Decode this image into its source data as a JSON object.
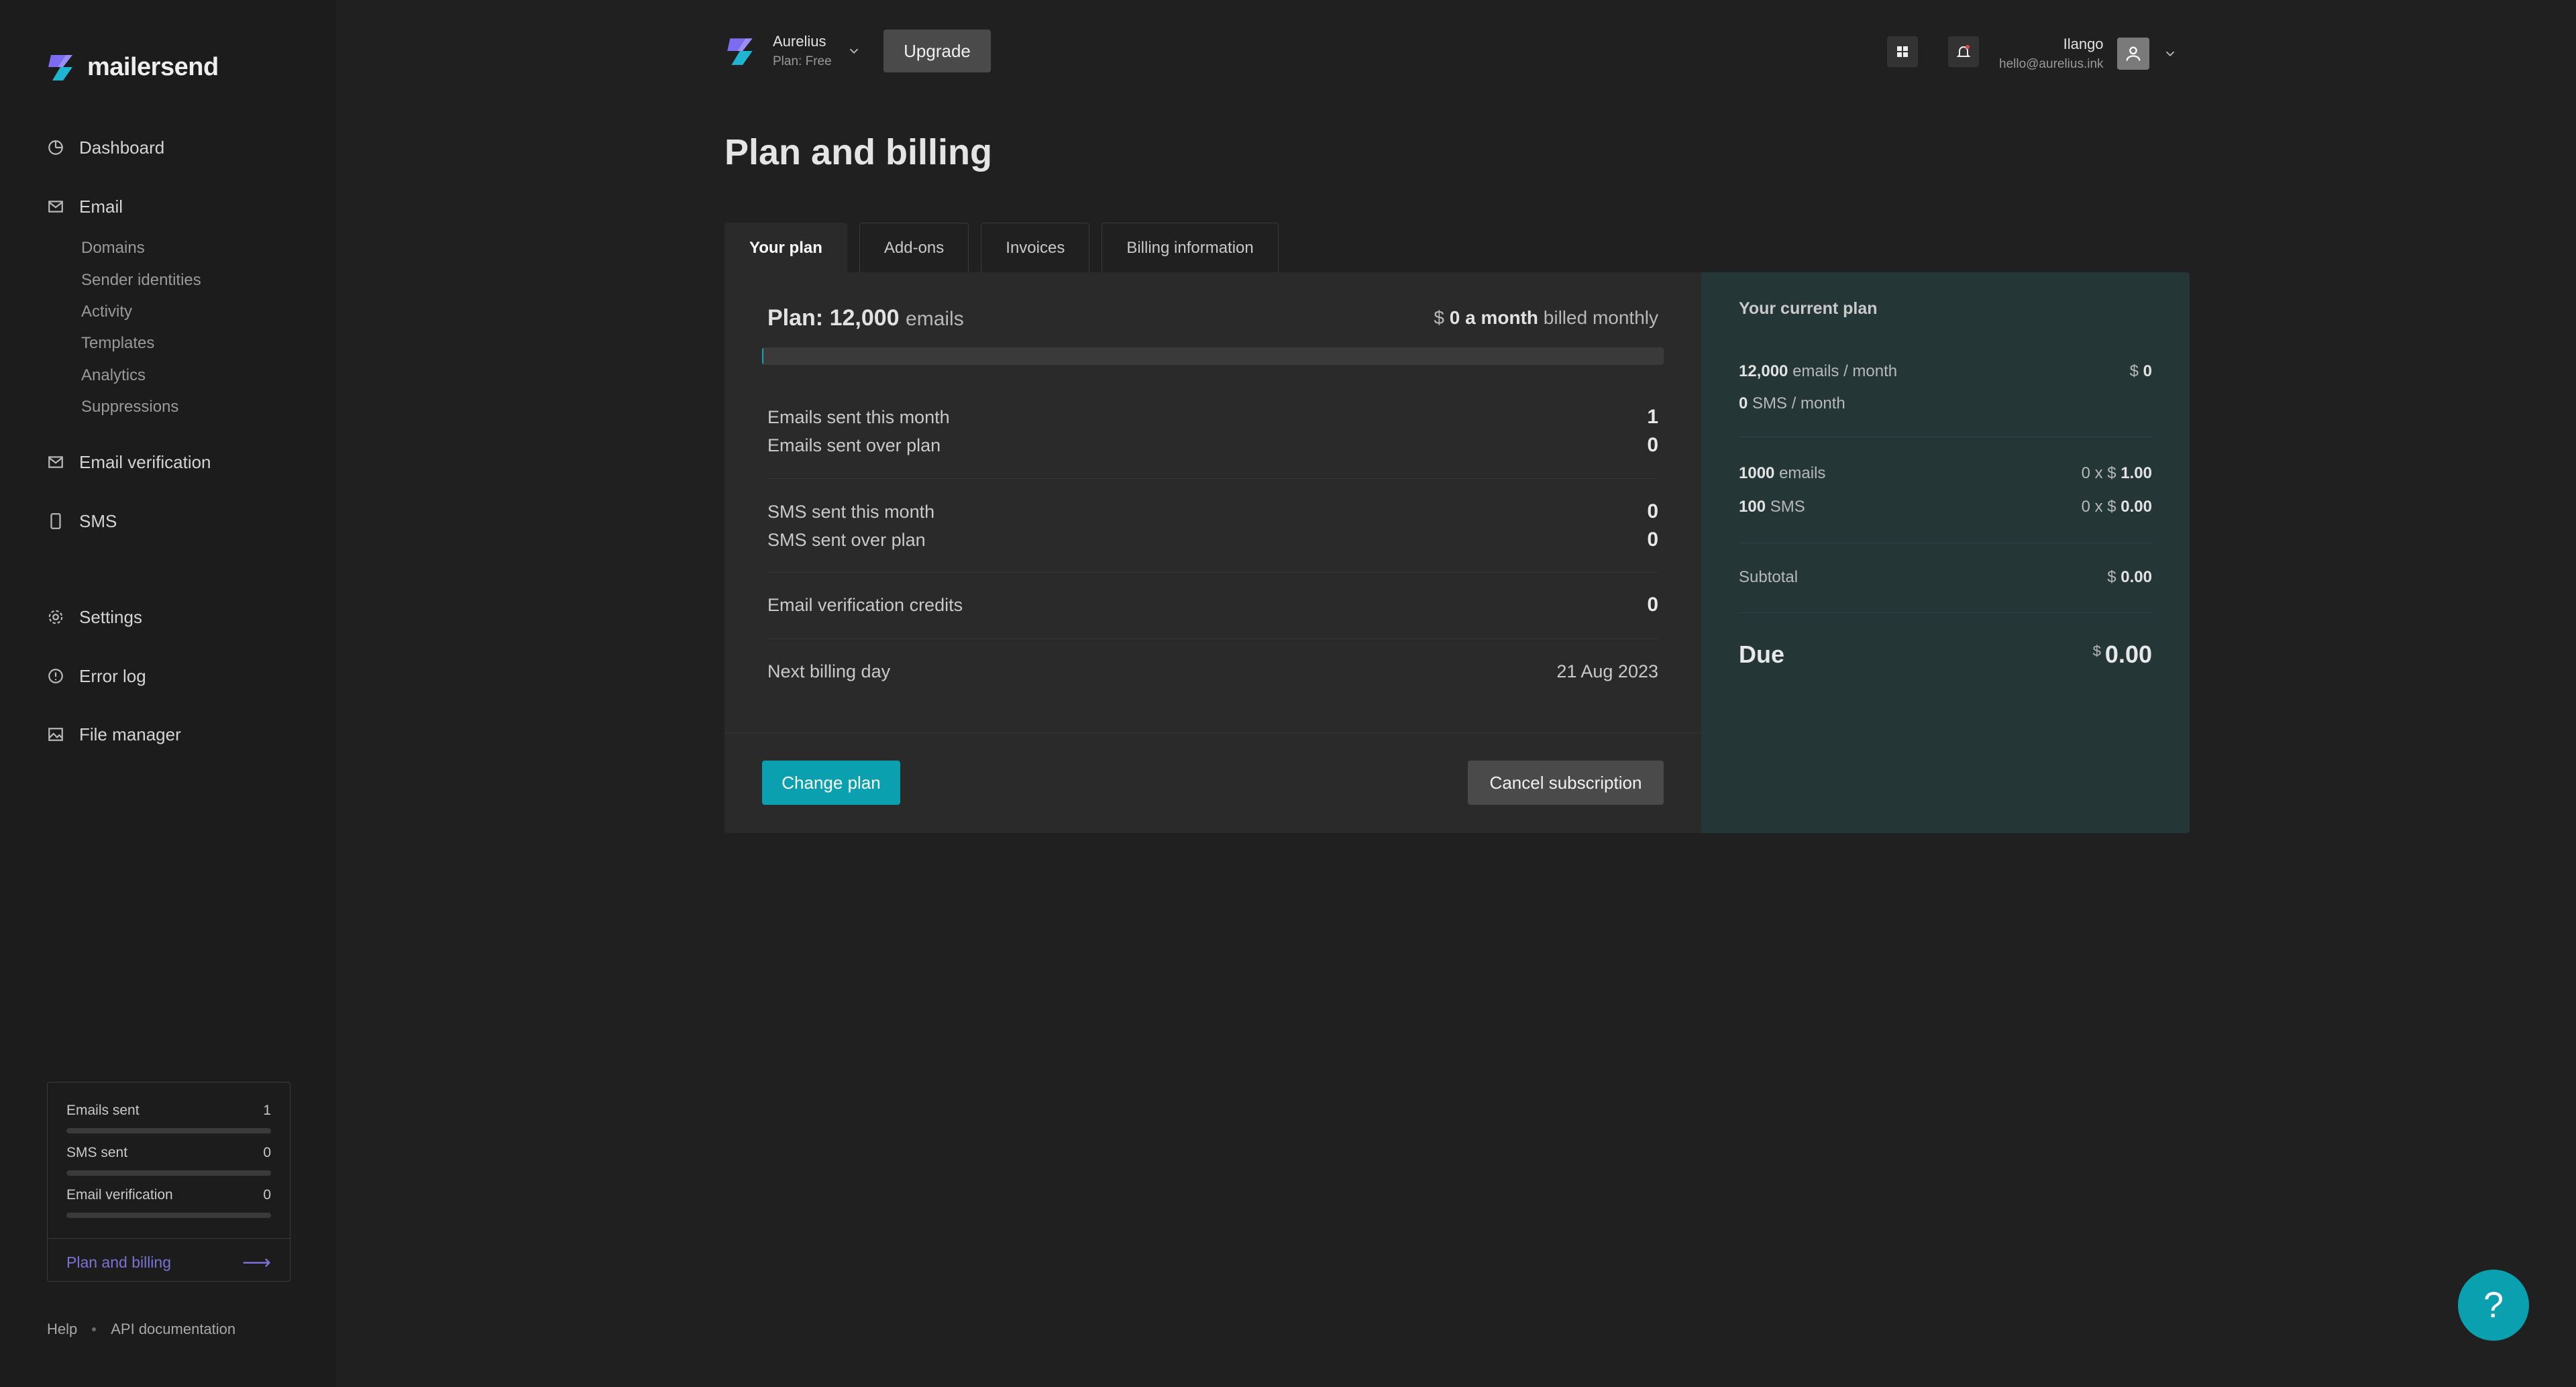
{
  "brand": {
    "name": "mailersend"
  },
  "sidebar": {
    "items": [
      {
        "label": "Dashboard",
        "icon": "dashboard-icon"
      },
      {
        "label": "Email",
        "icon": "mail-icon"
      },
      {
        "label": "Email verification",
        "icon": "mail-check-icon"
      },
      {
        "label": "SMS",
        "icon": "phone-icon"
      },
      {
        "label": "Settings",
        "icon": "gear-icon"
      },
      {
        "label": "Error log",
        "icon": "alert-circle-icon"
      },
      {
        "label": "File manager",
        "icon": "image-icon"
      }
    ],
    "email_sub": [
      "Domains",
      "Sender identities",
      "Activity",
      "Templates",
      "Analytics",
      "Suppressions"
    ],
    "usage": {
      "rows": [
        {
          "label": "Emails sent",
          "value": "1"
        },
        {
          "label": "SMS sent",
          "value": "0"
        },
        {
          "label": "Email verification",
          "value": "0"
        }
      ],
      "link": "Plan and billing",
      "link_arrow": "⟶"
    },
    "footer": {
      "help": "Help",
      "api": "API documentation"
    }
  },
  "topbar": {
    "account_name": "Aurelius",
    "account_plan": "Plan: Free",
    "upgrade_label": "Upgrade",
    "user_name": "Ilango",
    "user_email": "hello@aurelius.ink"
  },
  "page": {
    "title": "Plan and billing",
    "tabs": [
      "Your plan",
      "Add-ons",
      "Invoices",
      "Billing information"
    ],
    "active_tab": "Your plan"
  },
  "plan": {
    "prefix": "Plan:",
    "amount": "12,000",
    "unit": "emails",
    "price_currency": "$",
    "price_value": "0 a month",
    "price_suffix": "billed monthly",
    "usage_fraction": 0.0001,
    "rows": [
      {
        "label": "Emails sent this month",
        "value": "1"
      },
      {
        "label": "Emails sent over plan",
        "value": "0"
      },
      {
        "label": "SMS sent this month",
        "value": "0"
      },
      {
        "label": "SMS sent over plan",
        "value": "0"
      },
      {
        "label": "Email verification credits",
        "value": "0"
      },
      {
        "label": "Next billing day",
        "value": "21 Aug 2023"
      }
    ],
    "change_label": "Change plan",
    "cancel_label": "Cancel subscription"
  },
  "current_plan": {
    "title": "Your current plan",
    "emails_amount": "12,000",
    "emails_unit": "emails / month",
    "emails_price_cur": "$",
    "emails_price": "0",
    "sms_amount": "0",
    "sms_unit": "SMS / month",
    "addon_emails_amount": "1000",
    "addon_emails_unit": "emails",
    "addon_emails_mult": "0 x $",
    "addon_emails_price": "1.00",
    "addon_sms_amount": "100",
    "addon_sms_unit": "SMS",
    "addon_sms_mult": "0 x $",
    "addon_sms_price": "0.00",
    "subtotal_label": "Subtotal",
    "subtotal_cur": "$",
    "subtotal_value": "0.00",
    "due_label": "Due",
    "due_cur": "$",
    "due_value": "0.00"
  },
  "help_fab": {
    "label": "?"
  },
  "colors": {
    "accent": "#0aa0b0",
    "link": "#7b72d6",
    "panel": "#253637"
  }
}
